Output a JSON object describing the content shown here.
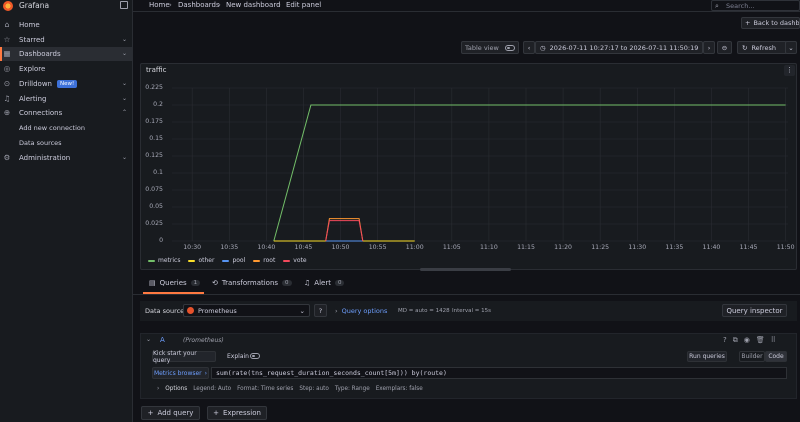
{
  "app": {
    "name": "Grafana"
  },
  "sidebar": {
    "items": [
      {
        "label": "Home",
        "icon": "home-icon"
      },
      {
        "label": "Starred",
        "icon": "star-icon"
      },
      {
        "label": "Dashboards",
        "icon": "apps-icon"
      },
      {
        "label": "Explore",
        "icon": "compass-icon"
      },
      {
        "label": "Drilldown",
        "icon": "drilldown-icon",
        "badge": "New!"
      },
      {
        "label": "Alerting",
        "icon": "bell-icon"
      },
      {
        "label": "Connections",
        "icon": "plug-icon"
      },
      {
        "label": "Add new connection"
      },
      {
        "label": "Data sources"
      },
      {
        "label": "Administration",
        "icon": "cog-icon"
      }
    ]
  },
  "breadcrumb": {
    "items": [
      "Home",
      "Dashboards",
      "New dashboard",
      "Edit panel"
    ]
  },
  "search": {
    "placeholder": "Search..."
  },
  "toolbar": {
    "back_label": "Back to dashboard",
    "table_view_label": "Table view",
    "time_range": "2026-07-11 10:27:17 to 2026-07-11 11:50:19",
    "refresh_label": "Refresh"
  },
  "panel": {
    "title": "traffic"
  },
  "chart_data": {
    "type": "line",
    "title": "traffic",
    "ylim": [
      0,
      0.225
    ],
    "y_ticks": [
      "0.225",
      "0.2",
      "0.175",
      "0.15",
      "0.125",
      "0.1",
      "0.075",
      "0.05",
      "0.025",
      "0"
    ],
    "x_ticks": [
      "10:30",
      "10:35",
      "10:40",
      "10:45",
      "10:50",
      "10:55",
      "11:00",
      "11:05",
      "11:10",
      "11:15",
      "11:20",
      "11:25",
      "11:30",
      "11:35",
      "11:40",
      "11:45",
      "11:50"
    ],
    "legend_position": "bottom-left",
    "series": [
      {
        "name": "metrics",
        "color": "#73bf69",
        "x": [
          "10:41",
          "10:46",
          "11:50"
        ],
        "y": [
          0,
          0.2,
          0.2
        ]
      },
      {
        "name": "other",
        "color": "#fade2a",
        "x": [
          "10:41",
          "10:44",
          "10:58",
          "11:00"
        ],
        "y": [
          0,
          0,
          0,
          0
        ]
      },
      {
        "name": "pool",
        "color": "#5794f2",
        "x": [
          "10:48",
          "10:53"
        ],
        "y": [
          0,
          0
        ]
      },
      {
        "name": "root",
        "color": "#ff9830",
        "x": [
          "10:48",
          "10:48.5",
          "10:52.5",
          "10:53"
        ],
        "y": [
          0,
          0.033,
          0.033,
          0
        ]
      },
      {
        "name": "vote",
        "color": "#f2495c",
        "x": [
          "10:48",
          "10:48.5",
          "10:52.5",
          "10:53"
        ],
        "y": [
          0,
          0.03,
          0.03,
          0
        ]
      }
    ]
  },
  "tabs": [
    {
      "label": "Queries",
      "count": "1"
    },
    {
      "label": "Transformations",
      "count": "0"
    },
    {
      "label": "Alert",
      "count": "0"
    }
  ],
  "datasource": {
    "label": "Data source",
    "value": "Prometheus"
  },
  "query_options": {
    "label": "Query options",
    "summary": "MD = auto = 1428",
    "interval": "Interval = 15s"
  },
  "query_inspector_label": "Query inspector",
  "query": {
    "ref": "A",
    "source": "(Prometheus)",
    "kick_start_label": "Kick start your query",
    "explain_label": "Explain",
    "run_label": "Run queries",
    "builder_label": "Builder",
    "code_label": "Code",
    "metrics_browser_label": "Metrics browser",
    "expr": "sum(rate(tns_request_duration_seconds_count[5m])) by(route)",
    "options_label": "Options",
    "legend": "Legend: Auto",
    "format": "Format: Time series",
    "step": "Step: auto",
    "type": "Type: Range",
    "exemplars": "Exemplars: false"
  },
  "add_query_label": "Add query",
  "expression_label": "Expression"
}
